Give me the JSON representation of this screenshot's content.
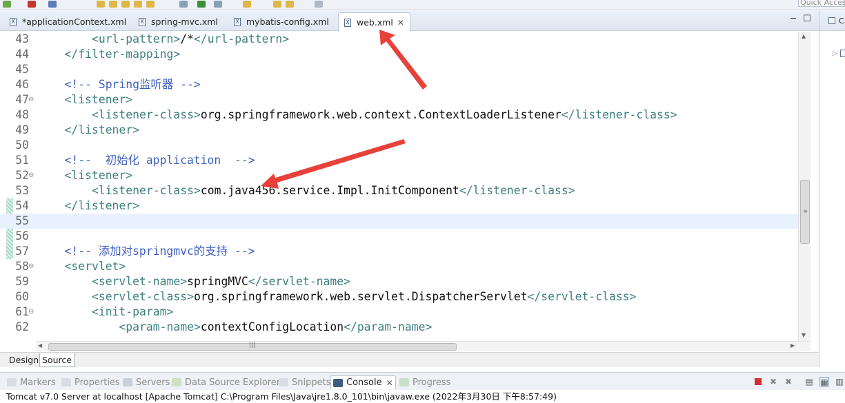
{
  "toolbar": {
    "quick_access_placeholder": "Quick Access"
  },
  "editor_tabs": [
    {
      "label": "*applicationContext.xml",
      "icon": "xml-file-icon",
      "active": false
    },
    {
      "label": "spring-mvc.xml",
      "icon": "xml-file-icon",
      "active": false
    },
    {
      "label": "mybatis-config.xml",
      "icon": "xml-file-icon",
      "active": false
    },
    {
      "label": "web.xml",
      "icon": "xml-file-icon",
      "active": true
    }
  ],
  "code_lines": [
    {
      "num": "43",
      "fold": "",
      "indent": "        ",
      "parts": [
        [
          "tag",
          "<url-pattern>"
        ],
        [
          "txt",
          "/*"
        ],
        [
          "tag",
          "</url-pattern>"
        ]
      ]
    },
    {
      "num": "44",
      "fold": "",
      "indent": "    ",
      "parts": [
        [
          "tag",
          "</filter-mapping>"
        ]
      ]
    },
    {
      "num": "45",
      "fold": "",
      "indent": "",
      "parts": []
    },
    {
      "num": "46",
      "fold": "",
      "indent": "    ",
      "parts": [
        [
          "cmt",
          "<!-- Spring监听器 -->"
        ]
      ]
    },
    {
      "num": "47",
      "fold": "⊖",
      "indent": "    ",
      "parts": [
        [
          "tag",
          "<listener>"
        ]
      ]
    },
    {
      "num": "48",
      "fold": "",
      "indent": "        ",
      "parts": [
        [
          "tag",
          "<listener-class>"
        ],
        [
          "txt",
          "org.springframework.web.context.ContextLoaderListener"
        ],
        [
          "tag",
          "</listener-class>"
        ]
      ]
    },
    {
      "num": "49",
      "fold": "",
      "indent": "    ",
      "parts": [
        [
          "tag",
          "</listener>"
        ]
      ]
    },
    {
      "num": "50",
      "fold": "",
      "indent": "",
      "parts": []
    },
    {
      "num": "51",
      "fold": "",
      "indent": "    ",
      "parts": [
        [
          "cmt",
          "<!--  初始化 application  -->"
        ]
      ]
    },
    {
      "num": "52",
      "fold": "⊖",
      "indent": "    ",
      "parts": [
        [
          "tag",
          "<listener>"
        ]
      ]
    },
    {
      "num": "53",
      "fold": "",
      "indent": "        ",
      "parts": [
        [
          "tag",
          "<listener-class>"
        ],
        [
          "txt",
          "com.java456.service.Impl.InitComponent"
        ],
        [
          "tag",
          "</listener-class>"
        ]
      ]
    },
    {
      "num": "54",
      "fold": "",
      "indent": "    ",
      "parts": [
        [
          "tag",
          "</listener>"
        ]
      ]
    },
    {
      "num": "55",
      "fold": "",
      "indent": "",
      "parts": [],
      "current": true
    },
    {
      "num": "56",
      "fold": "",
      "indent": "",
      "parts": []
    },
    {
      "num": "57",
      "fold": "",
      "indent": "    ",
      "parts": [
        [
          "cmt",
          "<!-- 添加对springmvc的支持 -->"
        ]
      ]
    },
    {
      "num": "58",
      "fold": "⊖",
      "indent": "    ",
      "parts": [
        [
          "tag",
          "<servlet>"
        ]
      ]
    },
    {
      "num": "59",
      "fold": "",
      "indent": "        ",
      "parts": [
        [
          "tag",
          "<servlet-name>"
        ],
        [
          "txt",
          "springMVC"
        ],
        [
          "tag",
          "</servlet-name>"
        ]
      ]
    },
    {
      "num": "60",
      "fold": "",
      "indent": "        ",
      "parts": [
        [
          "tag",
          "<servlet-class>"
        ],
        [
          "txt",
          "org.springframework.web.servlet.DispatcherServlet"
        ],
        [
          "tag",
          "</servlet-class>"
        ]
      ]
    },
    {
      "num": "61",
      "fold": "⊖",
      "indent": "        ",
      "parts": [
        [
          "tag",
          "<init-param>"
        ]
      ]
    },
    {
      "num": "62",
      "fold": "",
      "indent": "            ",
      "parts": [
        [
          "tag",
          "<param-name>"
        ],
        [
          "txt",
          "contextConfigLocation"
        ],
        [
          "tag",
          "</param-name>"
        ]
      ]
    }
  ],
  "source_tabs": [
    {
      "label": "Design",
      "active": false
    },
    {
      "label": "Source",
      "active": true
    }
  ],
  "view_tabs": [
    {
      "label": "Markers",
      "icon": "markers-icon",
      "active": false
    },
    {
      "label": "Properties",
      "icon": "properties-icon",
      "active": false
    },
    {
      "label": "Servers",
      "icon": "servers-icon",
      "active": false
    },
    {
      "label": "Data Source Explorer",
      "icon": "data-source-icon",
      "active": false
    },
    {
      "label": "Snippets",
      "icon": "snippets-icon",
      "active": false
    },
    {
      "label": "Console",
      "icon": "console-icon",
      "active": true
    },
    {
      "label": "Progress",
      "icon": "progress-icon",
      "active": false
    }
  ],
  "console": {
    "status_line": "Tomcat v7.0 Server at localhost [Apache Tomcat] C:\\Program Files\\Java\\jre1.8.0_101\\bin\\javaw.exe (2022年3月30日 下午8:57:49)"
  },
  "colors": {
    "tag": "#3f7f7f",
    "comment": "#3f5fbf",
    "annotation_arrow": "#e8403a",
    "current_line": "#e8f2fe"
  }
}
